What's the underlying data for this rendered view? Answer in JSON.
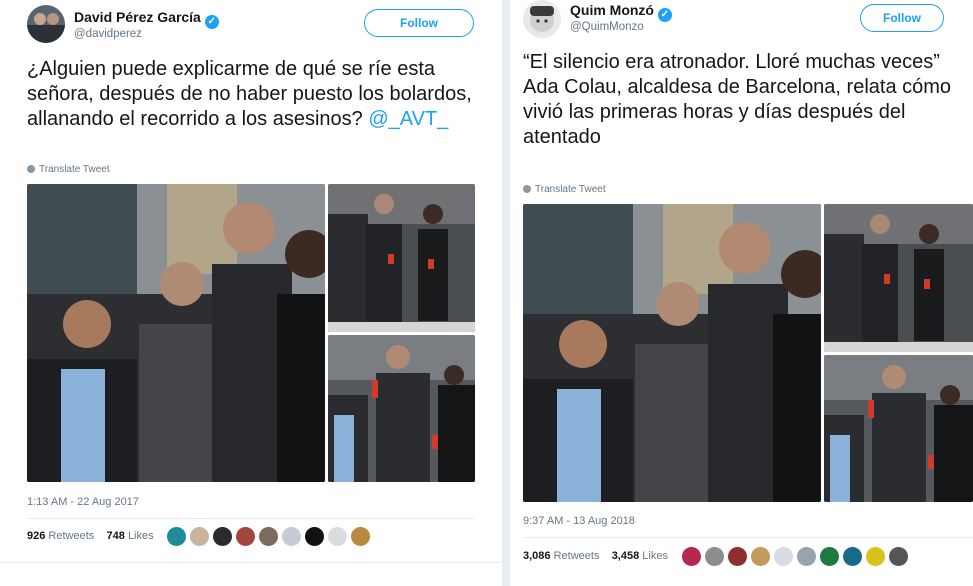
{
  "tweets": [
    {
      "author_name": "David Pérez García",
      "handle": "@davidperez",
      "follow_label": "Follow",
      "text_main": "¿Alguien puede explicarme de qué se ríe esta señora, después de no haber puesto los bolardos, allanando el recorrido a los asesinos? ",
      "mention": "@_AVT_",
      "translate_label": "Translate Tweet",
      "timestamp": "1:13 AM - 22 Aug 2017",
      "retweets_count": "926",
      "retweets_label": "Retweets",
      "likes_count": "748",
      "likes_label": "Likes"
    },
    {
      "author_name": "Quim Monzó",
      "handle": "@QuimMonzo",
      "follow_label": "Follow",
      "text_main": "“El silencio era atronador. Lloré muchas veces” Ada Colau, alcaldesa de Barcelona, relata cómo vivió las primeras horas y días después del atentado",
      "mention": "",
      "translate_label": "Translate Tweet",
      "timestamp": "9:37 AM - 13 Aug 2018",
      "retweets_count": "3,086",
      "retweets_label": "Retweets",
      "likes_count": "3,458",
      "likes_label": "Likes"
    }
  ],
  "icons": [
    "verified-badge-icon",
    "globe-icon"
  ],
  "colors": {
    "accent": "#1da1f2",
    "muted": "#657786",
    "text": "#14171a",
    "border": "#e6ecf0"
  }
}
